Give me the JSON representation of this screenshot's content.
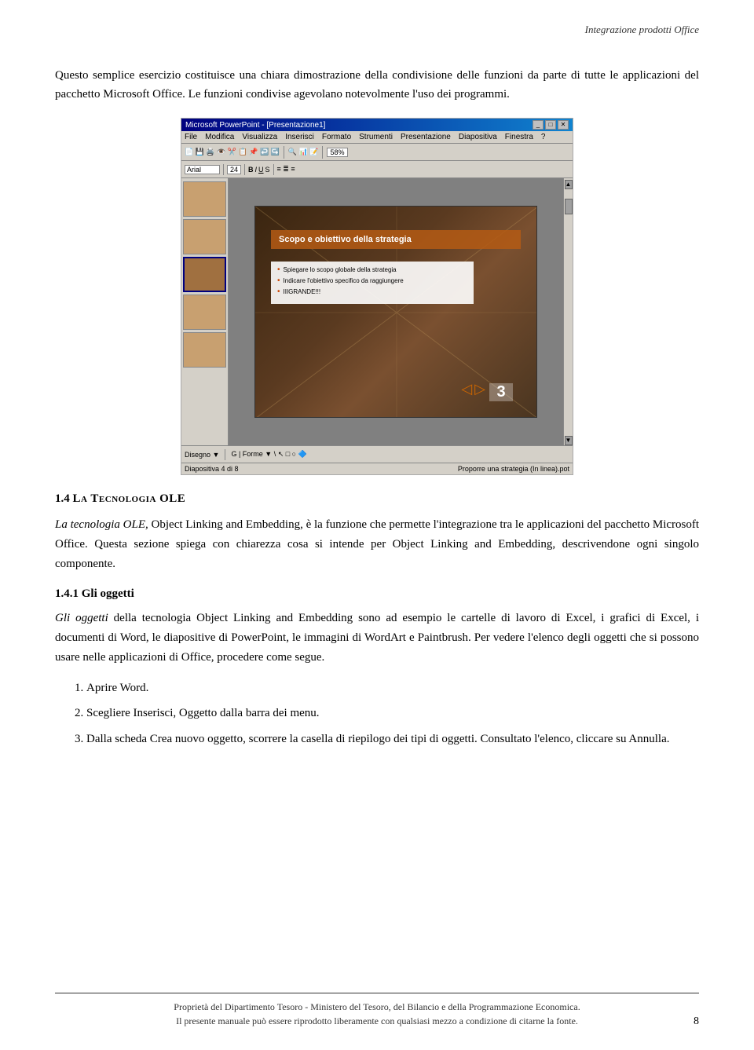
{
  "header": {
    "title": "Integrazione prodotti Office"
  },
  "intro": {
    "paragraph1": "Questo semplice esercizio costituisce una chiara dimostrazione della condivisione delle funzioni da parte di tutte le applicazioni del pacchetto Microsoft Office. Le funzioni condivise agevolano notevolmente l'uso dei programmi."
  },
  "screenshot": {
    "titlebar": "Microsoft PowerPoint - [Presentazione1]",
    "menu_items": [
      "File",
      "Modifica",
      "Visualizza",
      "Inserisci",
      "Formato",
      "Strumenti",
      "Presentazione",
      "Diapositiva",
      "Finestra",
      "?"
    ],
    "slide_title": "Scopo e obiettivo della strategia",
    "slide_bullets": [
      "Spiegare lo scopo globale della strategia",
      "Indicare l'obiettivo specifico da raggiungere",
      "IIIGRANDE!!!"
    ],
    "slide_number": "3",
    "status_left": "Diapositiva 4 di 8",
    "status_right": "Proporre una strategia (In linea).pot"
  },
  "section1_4": {
    "number": "1.4",
    "label": "La Tecnologia OLE",
    "paragraph": "La tecnologia OLE, Object Linking and Embedding, è la funzione che permette l'integrazione tra le applicazioni del pacchetto Microsoft Office. Questa sezione spiega con chiarezza cosa si intende per Object Linking and Embedding, descrivendone ogni singolo componente."
  },
  "section1_4_1": {
    "number": "1.4.1",
    "label": "Gli oggetti",
    "paragraph1": "Gli oggetti della tecnologia Object Linking and Embedding sono ad esempio le cartelle di lavoro di Excel, i grafici di Excel, i documenti di Word, le diapositive di PowerPoint, le immagini di WordArt e Paintbrush. Per vedere l'elenco degli oggetti che si possono usare nelle applicazioni di Office, procedere come segue.",
    "list": [
      "Aprire Word.",
      "Scegliere Inserisci, Oggetto dalla barra dei menu.",
      "Dalla scheda Crea nuovo oggetto, scorrere la casella di riepilogo dei tipi di oggetti. Consultato l'elenco, cliccare su Annulla."
    ]
  },
  "footer": {
    "line1": "Proprietà  del Dipartimento Tesoro - Ministero del Tesoro, del Bilancio e della Programmazione Economica.",
    "line2": "Il presente manuale può essere riprodotto liberamente con qualsiasi mezzo a condizione di citarne la fonte."
  },
  "page_number": "8"
}
